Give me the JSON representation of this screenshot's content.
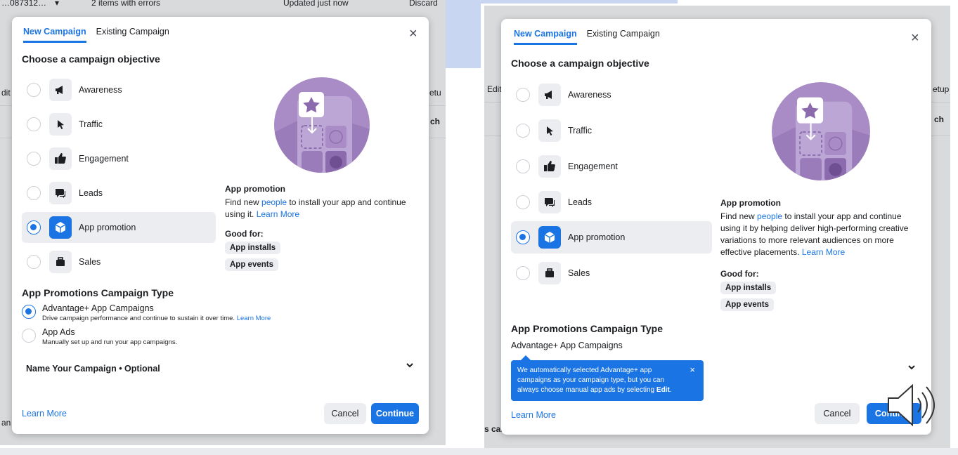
{
  "left": {
    "background": {
      "topbar_fragments": [
        "…087312…",
        "▾",
        "2 items with errors",
        "Updated just now",
        "Discard"
      ],
      "side_fragments": [
        "dit",
        "etu",
        "ch",
        "an"
      ]
    },
    "tabs": [
      {
        "label": "New Campaign",
        "active": true
      },
      {
        "label": "Existing Campaign",
        "active": false
      }
    ],
    "close_glyph": "×",
    "heading": "Choose a campaign objective",
    "objectives": [
      {
        "label": "Awareness",
        "icon": "megaphone-icon",
        "selected": false
      },
      {
        "label": "Traffic",
        "icon": "cursor-icon",
        "selected": false
      },
      {
        "label": "Engagement",
        "icon": "thumbs-up-icon",
        "selected": false
      },
      {
        "label": "Leads",
        "icon": "chat-bubble-icon",
        "selected": false
      },
      {
        "label": "App promotion",
        "icon": "cube-icon",
        "selected": true
      },
      {
        "label": "Sales",
        "icon": "briefcase-icon",
        "selected": false
      }
    ],
    "side": {
      "title": "App promotion",
      "desc_before": "Find new ",
      "desc_link": "people",
      "desc_after": " to install your app and continue using it. ",
      "learn_more": "Learn More",
      "good_for": "Good for:",
      "pills": [
        "App installs",
        "App events"
      ]
    },
    "type_heading": "App Promotions Campaign Type",
    "types": [
      {
        "title": "Advantage+ App Campaigns",
        "sub": "Drive campaign performance and continue to sustain it over time. ",
        "sub_link": "Learn More",
        "selected": true
      },
      {
        "title": "App Ads",
        "sub": "Manually set up and run your app campaigns.",
        "sub_link": "",
        "selected": false
      }
    ],
    "name_row": "Name Your Campaign • Optional",
    "chevron": "⌄",
    "footer_link": "Learn More",
    "cancel": "Cancel",
    "continue": "Continue"
  },
  "right": {
    "background": {
      "side_fragments": [
        "Edit",
        "etup",
        "ch",
        "s can"
      ]
    },
    "tabs": [
      {
        "label": "New Campaign",
        "active": true
      },
      {
        "label": "Existing Campaign",
        "active": false
      }
    ],
    "close_glyph": "×",
    "heading": "Choose a campaign objective",
    "objectives": [
      {
        "label": "Awareness",
        "icon": "megaphone-icon",
        "selected": false
      },
      {
        "label": "Traffic",
        "icon": "cursor-icon",
        "selected": false
      },
      {
        "label": "Engagement",
        "icon": "thumbs-up-icon",
        "selected": false
      },
      {
        "label": "Leads",
        "icon": "chat-bubble-icon",
        "selected": false
      },
      {
        "label": "App promotion",
        "icon": "cube-icon",
        "selected": true
      },
      {
        "label": "Sales",
        "icon": "briefcase-icon",
        "selected": false
      }
    ],
    "side": {
      "title": "App promotion",
      "desc_before": "Find new ",
      "desc_link": "people",
      "desc_after": " to install your app and continue using it by helping deliver high-performing creative variations to more relevant audiences on more effective placements.  ",
      "learn_more": "Learn More",
      "good_for": "Good for:",
      "pills": [
        "App installs",
        "App events"
      ]
    },
    "type_heading": "App Promotions Campaign Type",
    "type_value": "Advantage+ App Campaigns",
    "tooltip": {
      "text": "We automatically selected Advantage+ app campaigns as your campaign type, but you can always choose manual app ads by selecting ",
      "bold": "Edit",
      "end": ".",
      "close": "×"
    },
    "chevron": "⌄",
    "footer_link": "Learn More",
    "cancel": "Cancel",
    "continue": "Continue"
  },
  "colors": {
    "accent": "#1b74e4",
    "illustration_purple": "#a98bc6",
    "backdrop_blue": "#c9d6f2"
  },
  "overlay_icon": "speaker-icon"
}
